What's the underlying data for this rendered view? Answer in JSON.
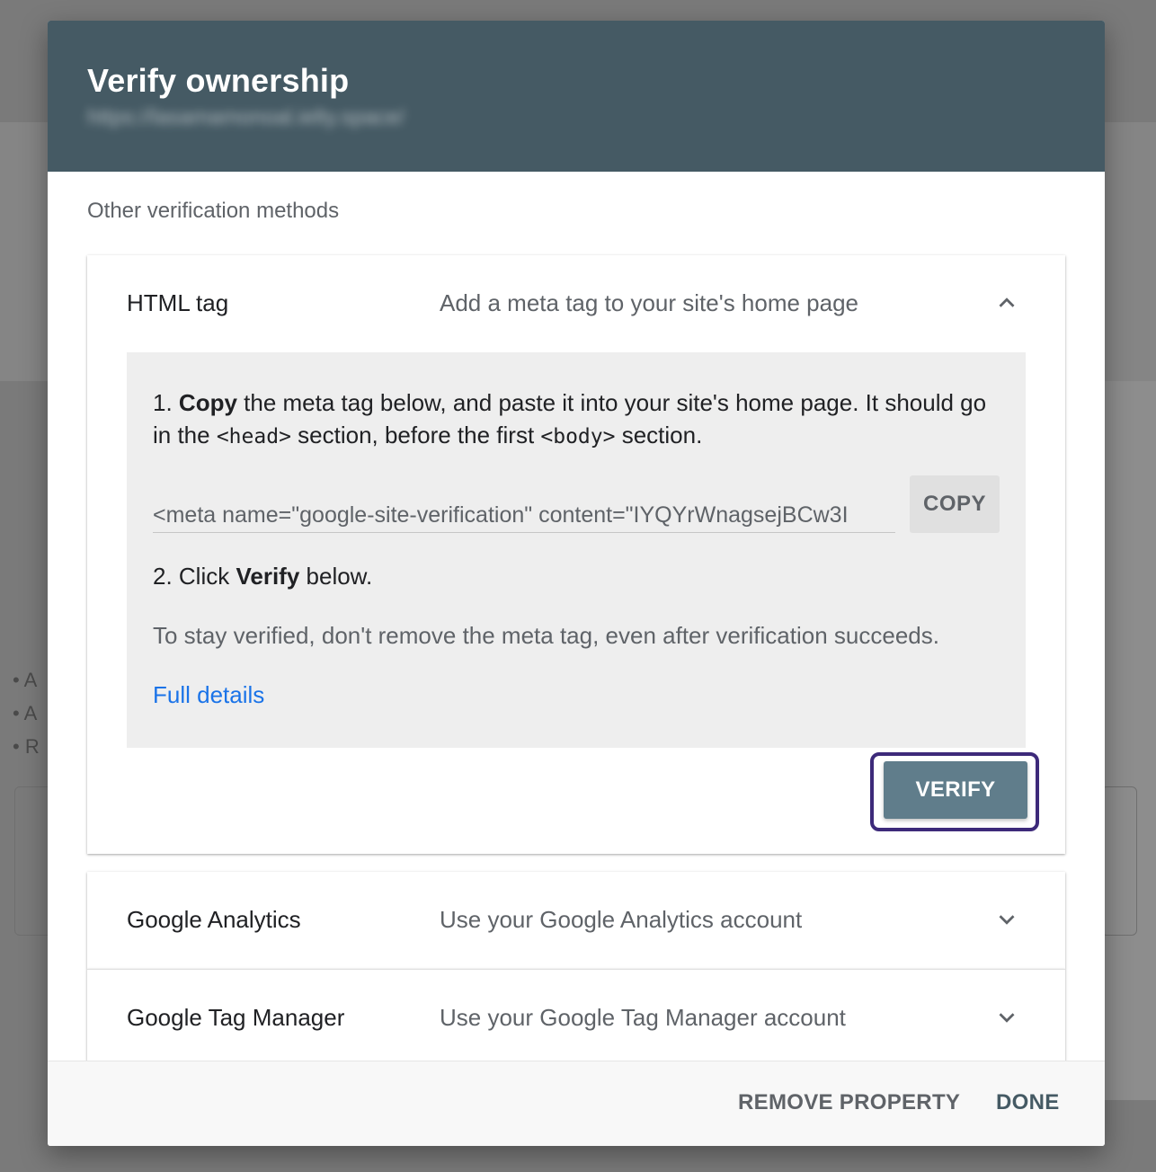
{
  "background": {
    "bullets": [
      "A",
      "A",
      "R"
    ]
  },
  "dialog": {
    "title": "Verify ownership",
    "url": "https://lasamamonoal.ielty.space/",
    "section_label": "Other verification methods",
    "methods": [
      {
        "name": "HTML tag",
        "description": "Add a meta tag to your site's home page",
        "expanded": true,
        "chevron": "chevron-up-icon",
        "steps": {
          "step1_prefix": "1. ",
          "step1_bold": "Copy",
          "step1_text_a": " the meta tag below, and paste it into your site's home page. It should go in the ",
          "step1_code_head": "<head>",
          "step1_text_b": " section, before the first ",
          "step1_code_body": "<body>",
          "step1_text_c": " section.",
          "meta_tag_value": "<meta name=\"google-site-verification\" content=\"IYQYrWnagsejBCw3I",
          "copy_label": "COPY",
          "step2_prefix": "2. Click ",
          "step2_bold": "Verify",
          "step2_suffix": " below.",
          "note": "To stay verified, don't remove the meta tag, even after verification succeeds.",
          "details_link": "Full details"
        },
        "verify_label": "VERIFY"
      },
      {
        "name": "Google Analytics",
        "description": "Use your Google Analytics account",
        "expanded": false,
        "chevron": "chevron-down-icon"
      },
      {
        "name": "Google Tag Manager",
        "description": "Use your Google Tag Manager account",
        "expanded": false,
        "chevron": "chevron-down-icon"
      }
    ],
    "footer": {
      "remove_label": "REMOVE PROPERTY",
      "done_label": "DONE"
    }
  },
  "colors": {
    "header": "#455a64",
    "verify_button": "#607d8b",
    "link": "#1a73e8",
    "highlight_frame": "#3d2a7a"
  }
}
